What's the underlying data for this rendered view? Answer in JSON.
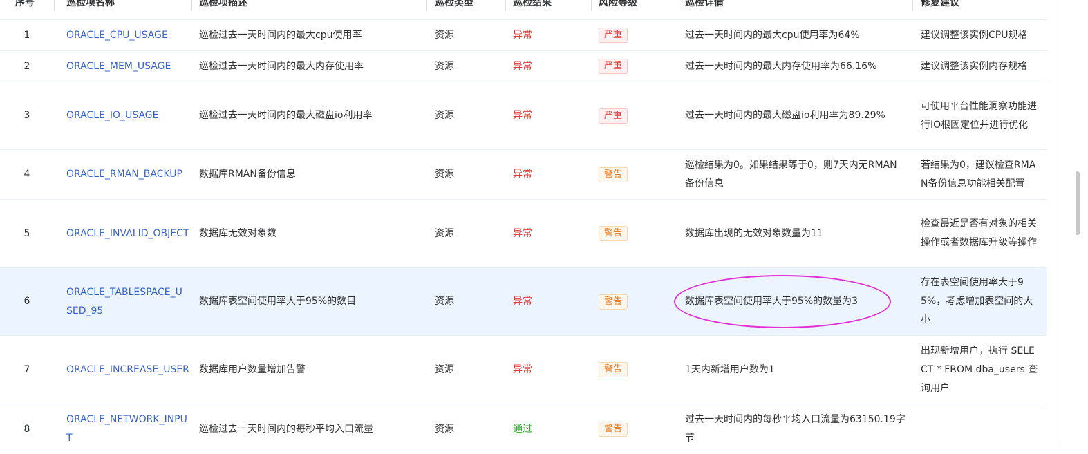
{
  "headers": {
    "idx": "序号",
    "name": "巡检项名称",
    "desc": "巡检项描述",
    "type": "巡检类型",
    "result": "巡检结果",
    "risk": "风险等级",
    "detail": "巡检详情",
    "fix": "修复建议"
  },
  "rows": [
    {
      "idx": "1",
      "name": "ORACLE_CPU_USAGE",
      "desc": "巡检过去一天时间内的最大cpu使用率",
      "type": "资源",
      "result": "异常",
      "risk": "严重",
      "detail": "过去一天时间内的最大cpu使用率为64%",
      "fix": "建议调整该实例CPU规格"
    },
    {
      "idx": "2",
      "name": "ORACLE_MEM_USAGE",
      "desc": "巡检过去一天时间内的最大内存使用率",
      "type": "资源",
      "result": "异常",
      "risk": "严重",
      "detail": "过去一天时间内的最大内存使用率为66.16%",
      "fix": "建议调整该实例内存规格"
    },
    {
      "idx": "3",
      "name": "ORACLE_IO_USAGE",
      "desc": "巡检过去一天时间内的最大磁盘io利用率",
      "type": "资源",
      "result": "异常",
      "risk": "严重",
      "detail": "过去一天时间内的最大磁盘io利用率为89.29%",
      "fix": "可使用平台性能洞察功能进行IO根因定位并进行优化"
    },
    {
      "idx": "4",
      "name": "ORACLE_RMAN_BACKUP",
      "desc": "数据库RMAN备份信息",
      "type": "资源",
      "result": "异常",
      "risk": "警告",
      "detail": "巡检结果为0。如果结果等于0，则7天内无RMAN备份信息",
      "fix": "若结果为0，建议检查RMAN备份信息功能相关配置"
    },
    {
      "idx": "5",
      "name": "ORACLE_INVALID_OBJECT",
      "desc": "数据库无效对象数",
      "type": "资源",
      "result": "异常",
      "risk": "警告",
      "detail": "数据库出现的无效对象数量为11",
      "fix": "检查最近是否有对象的相关操作或者数据库升级等操作"
    },
    {
      "idx": "6",
      "name": "ORACLE_TABLESPACE_USED_95",
      "desc": "数据库表空间使用率大于95%的数目",
      "type": "资源",
      "result": "异常",
      "risk": "警告",
      "detail": "数据库表空间使用率大于95%的数量为3",
      "fix": "存在表空间使用率大于95%，考虑增加表空间的大小"
    },
    {
      "idx": "7",
      "name": "ORACLE_INCREASE_USER",
      "desc": "数据库用户数量增加告警",
      "type": "资源",
      "result": "异常",
      "risk": "警告",
      "detail": "1天内新增用户数为1",
      "fix": "出现新增用户，执行 SELECT * FROM dba_users 查询用户"
    },
    {
      "idx": "8",
      "name": "ORACLE_NETWORK_INPUT",
      "desc": "巡检过去一天时间内的每秒平均入口流量",
      "type": "资源",
      "result": "通过",
      "risk": "警告",
      "detail": "过去一天时间内的每秒平均入口流量为63150.19字节",
      "fix": ""
    }
  ]
}
